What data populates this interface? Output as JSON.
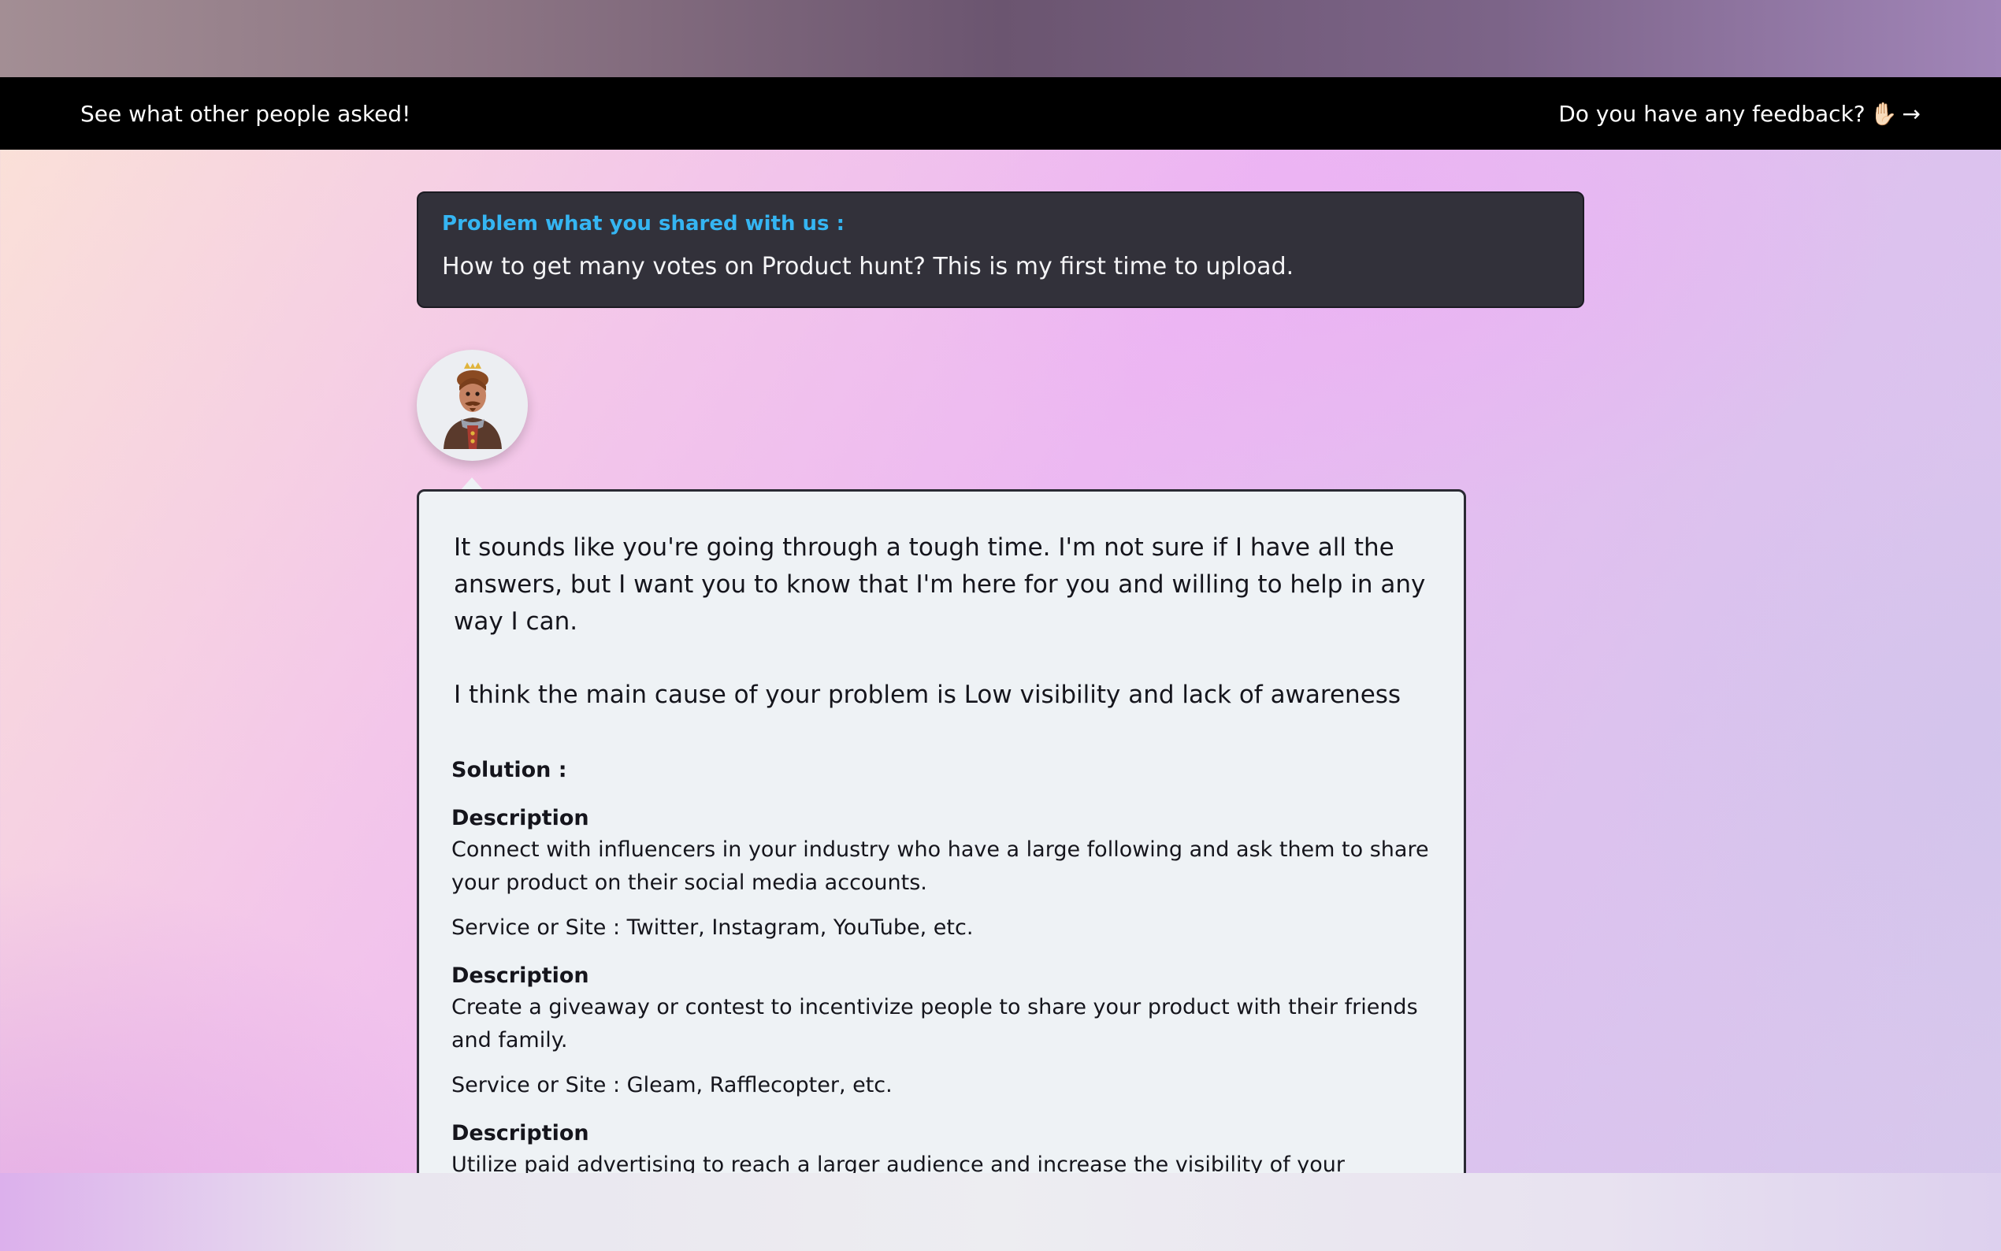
{
  "nav": {
    "left_link": "See what other people asked!",
    "right_link": "Do you have any feedback?",
    "right_emoji": "✋🏻",
    "right_arrow": "→"
  },
  "problem": {
    "label": "Problem what you shared with us :",
    "text": "How to get many votes on Product hunt? This is my first time to upload."
  },
  "avatar": {
    "icon": "king-avatar-icon"
  },
  "answer": {
    "empathy": "It sounds like you're going through a tough time. I'm not sure if I have all the answers, but I want you to know that I'm here for you and willing to help in any way I can.",
    "cause": "I think the main cause of your problem is Low visibility and lack of awareness",
    "solution_title": "Solution :",
    "solutions": [
      {
        "heading": "Description",
        "text": "Connect with influencers in your industry who have a large following and ask them to share your product on their social media accounts.",
        "service": "Service or Site : Twitter, Instagram, YouTube, etc."
      },
      {
        "heading": "Description",
        "text": "Create a giveaway or contest to incentivize people to share your product with their friends and family.",
        "service": "Service or Site : Gleam, Rafflecopter, etc."
      },
      {
        "heading": "Description",
        "text": "Utilize paid advertising to reach a larger audience and increase the visibility of your product.",
        "service": ""
      }
    ]
  },
  "colors": {
    "navbar": "#000000",
    "problem_card": "#32313a",
    "problem_label": "#35b5f2",
    "answer_card": "#eef2f5"
  }
}
